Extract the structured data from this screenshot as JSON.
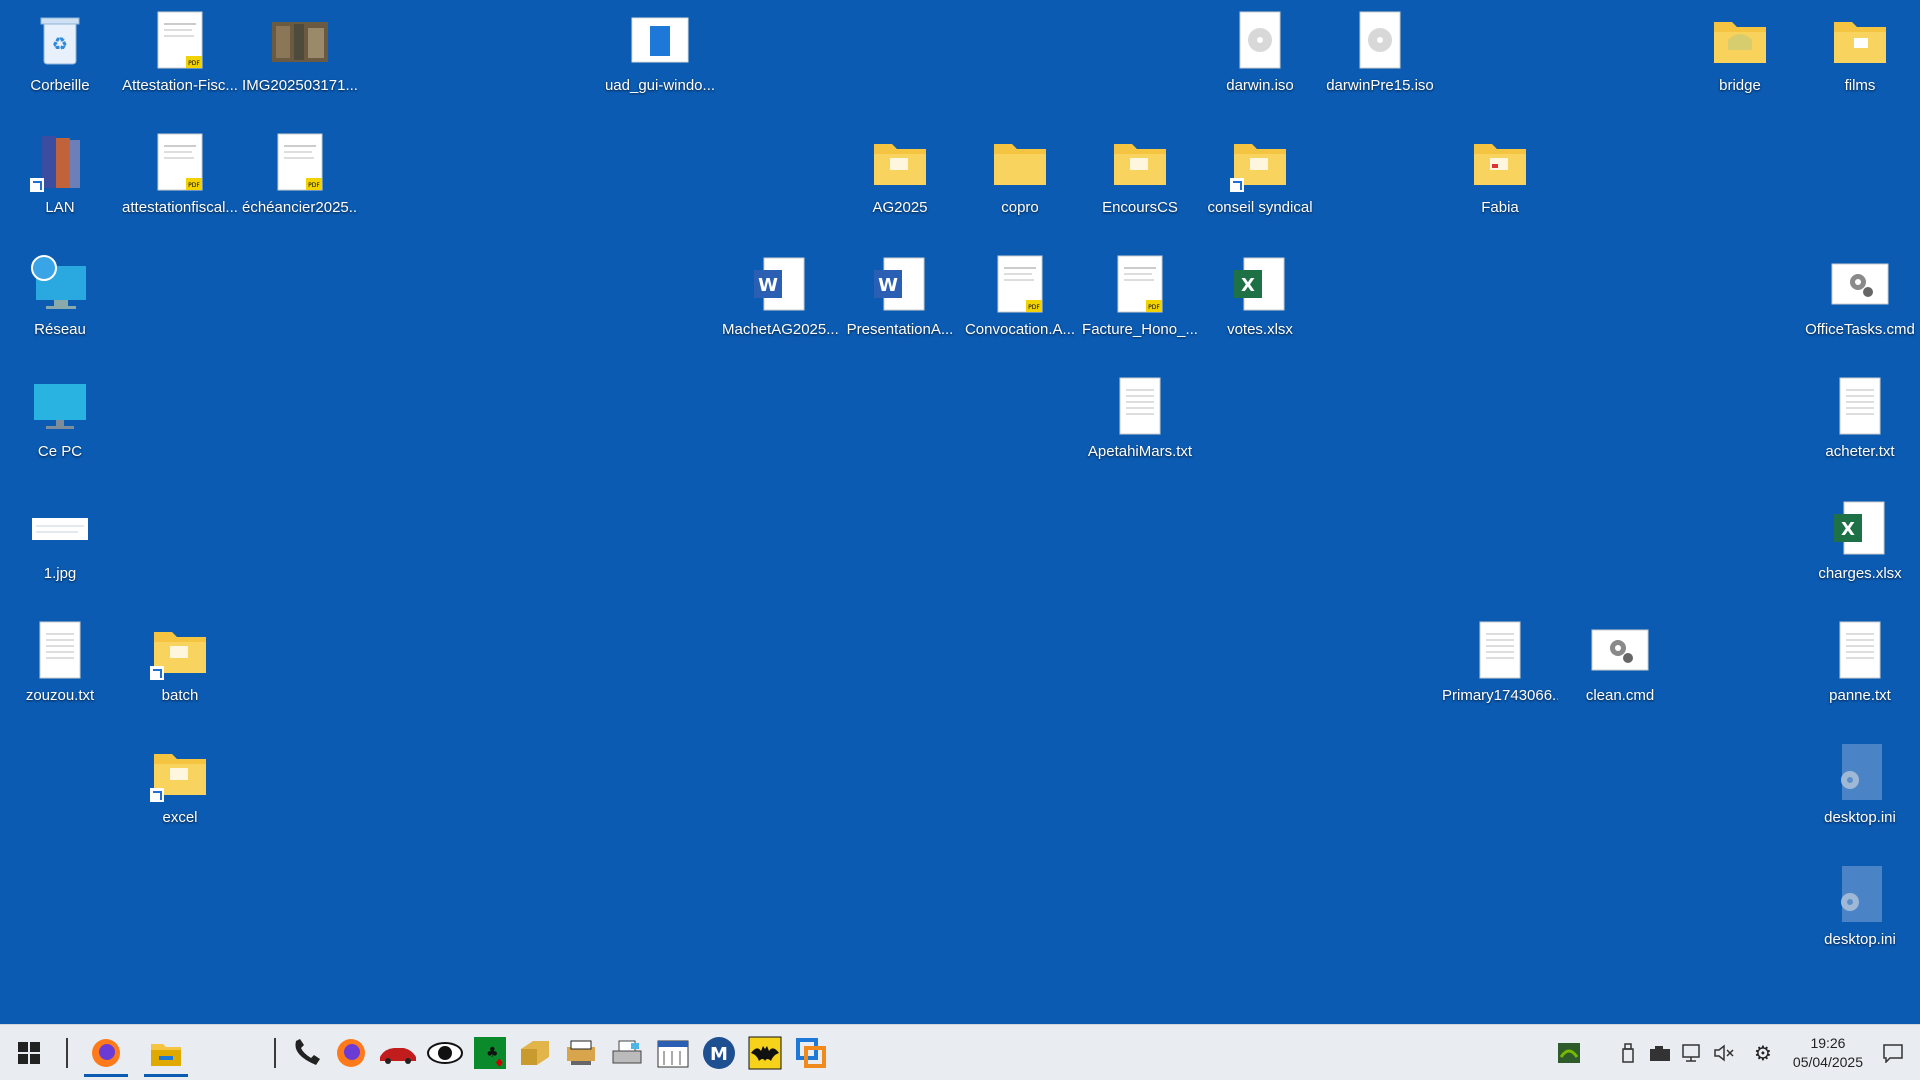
{
  "desktop": {
    "icons": {
      "corbeille": "Corbeille",
      "attestation_fisc": "Attestation-Fisc...",
      "img": "IMG202503171...",
      "uad_gui": "uad_gui-windo...",
      "darwin": "darwin.iso",
      "darwinpre": "darwinPre15.iso",
      "bridge": "bridge",
      "films": "films",
      "lan": "LAN",
      "attestationfiscal": "attestationfiscal...",
      "echeancier": "échéancier2025....",
      "ag2025": "AG2025",
      "copro": "copro",
      "encourscs": "EncoursCS",
      "conseil": "conseil syndical",
      "fabia": "Fabia",
      "reseau": "Réseau",
      "machet": "MachetAG2025....",
      "presentation": "PresentationA...",
      "convocation": "Convocation.A...",
      "facture": "Facture_Hono_...",
      "votes": "votes.xlsx",
      "officetasks": "OfficeTasks.cmd",
      "cepc": "Ce PC",
      "apetahi": "ApetahiMars.txt",
      "acheter": "acheter.txt",
      "jpg1": "1.jpg",
      "charges": "charges.xlsx",
      "zouzou": "zouzou.txt",
      "batch": "batch",
      "primary": "Primary1743066...",
      "clean": "clean.cmd",
      "panne": "panne.txt",
      "excel": "excel",
      "desktopini1": "desktop.ini",
      "desktopini2": "desktop.ini"
    }
  },
  "taskbar": {
    "clock_time": "19:26",
    "clock_date": "05/04/2025"
  },
  "colors": {
    "desktop_bg": "#0b5bb3",
    "folder": "#f5c542",
    "word": "#2b5fb4",
    "excel": "#1d7145",
    "taskbar_bg": "#e9edf2"
  }
}
